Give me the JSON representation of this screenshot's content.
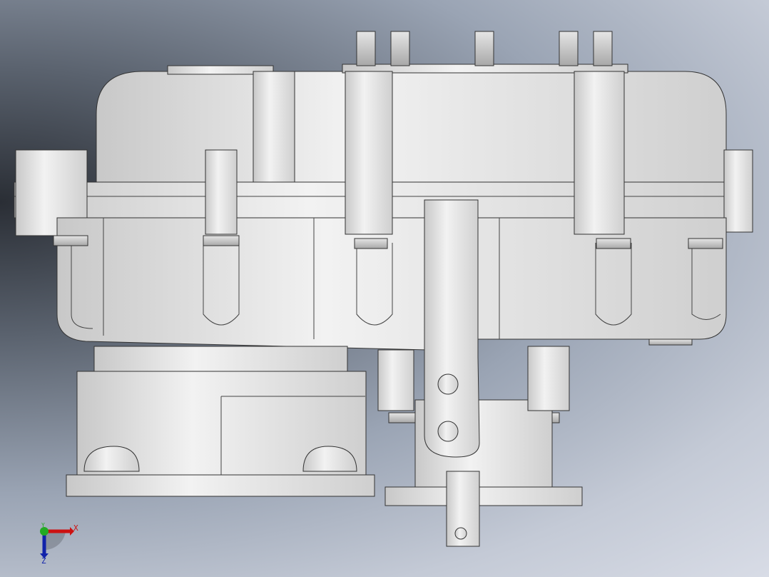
{
  "view": {
    "triad": {
      "x_label": "X",
      "y_label": "Y",
      "z_label": "Z"
    },
    "colors": {
      "x_axis": "#cc1111",
      "y_axis": "#22aa22",
      "z_axis": "#1122aa",
      "model": "#e2e2e2"
    }
  }
}
